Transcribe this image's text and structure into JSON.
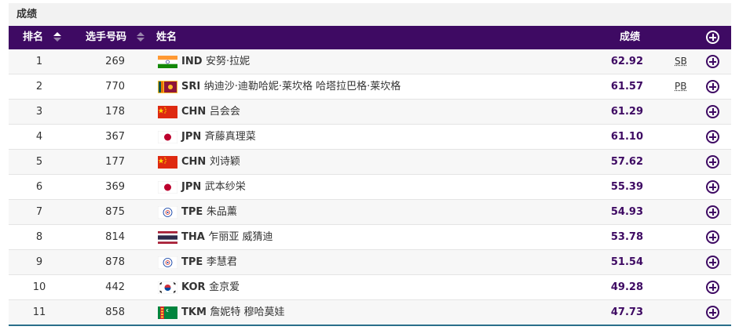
{
  "title": "成绩",
  "header": {
    "rank": "排名",
    "bib": "选手号码",
    "name": "姓名",
    "result": "成绩"
  },
  "colors": {
    "header_bg": "#3e0a63",
    "accent": "#3e0a63"
  },
  "rows": [
    {
      "rank": "1",
      "bib": "269",
      "code": "IND",
      "name": "安努·拉妮",
      "result": "62.92",
      "record": "SB",
      "flag": "IND"
    },
    {
      "rank": "2",
      "bib": "770",
      "code": "SRI",
      "name": "纳迪沙·迪勒哈妮·莱坎格 哈塔拉巴格·莱坎格",
      "result": "61.57",
      "record": "PB",
      "flag": "SRI"
    },
    {
      "rank": "3",
      "bib": "178",
      "code": "CHN",
      "name": "吕会会",
      "result": "61.29",
      "record": "",
      "flag": "CHN"
    },
    {
      "rank": "4",
      "bib": "367",
      "code": "JPN",
      "name": "斉藤真理菜",
      "result": "61.10",
      "record": "",
      "flag": "JPN"
    },
    {
      "rank": "5",
      "bib": "177",
      "code": "CHN",
      "name": "刘诗颖",
      "result": "57.62",
      "record": "",
      "flag": "CHN"
    },
    {
      "rank": "6",
      "bib": "369",
      "code": "JPN",
      "name": "武本纱栄",
      "result": "55.39",
      "record": "",
      "flag": "JPN"
    },
    {
      "rank": "7",
      "bib": "875",
      "code": "TPE",
      "name": "朱品薰",
      "result": "54.93",
      "record": "",
      "flag": "TPE"
    },
    {
      "rank": "8",
      "bib": "814",
      "code": "THA",
      "name": "乍丽亚 威猜迪",
      "result": "53.78",
      "record": "",
      "flag": "THA"
    },
    {
      "rank": "9",
      "bib": "878",
      "code": "TPE",
      "name": "李慧君",
      "result": "51.54",
      "record": "",
      "flag": "TPE"
    },
    {
      "rank": "10",
      "bib": "442",
      "code": "KOR",
      "name": "金京爱",
      "result": "49.28",
      "record": "",
      "flag": "KOR"
    },
    {
      "rank": "11",
      "bib": "858",
      "code": "TKM",
      "name": "詹妮特 穆哈莫娃",
      "result": "47.73",
      "record": "",
      "flag": "TKM"
    }
  ]
}
